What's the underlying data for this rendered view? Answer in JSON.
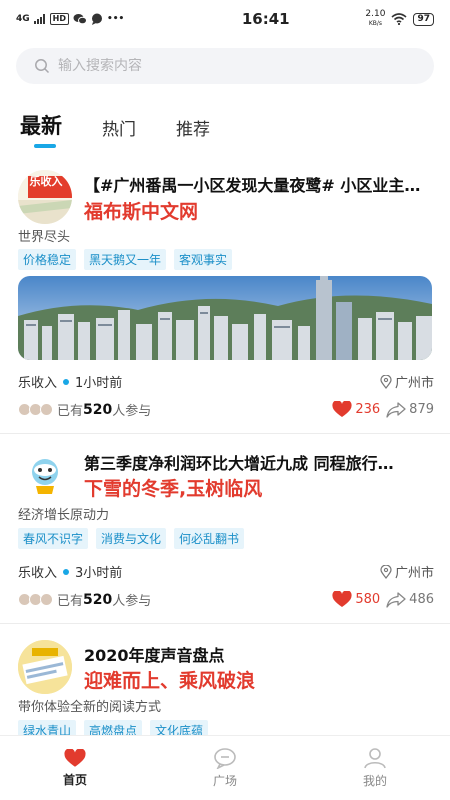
{
  "status_bar": {
    "signal_label": "4G",
    "hd_label": "HD",
    "more": "•••",
    "time": "16:41",
    "speed_value": "2.10",
    "speed_unit": "KB/s",
    "battery": "97"
  },
  "search": {
    "placeholder": "输入搜索内容"
  },
  "tabs": [
    {
      "label": "最新",
      "active": true
    },
    {
      "label": "热门",
      "active": false
    },
    {
      "label": "推荐",
      "active": false
    }
  ],
  "posts": [
    {
      "avatar_text": "乐收入",
      "title": "【#广州番禺一小区发现大量夜鹭# 小区业主称…",
      "subtitle": "福布斯中文网",
      "desc": "世界尽头",
      "tags": [
        "价格稳定",
        "黑天鹅又一年",
        "客观事实"
      ],
      "author": "乐收入",
      "time": "1小时前",
      "location": "广州市",
      "participants_prefix": "已有",
      "participants_count": "520",
      "participants_suffix": "人参与",
      "likes": "236",
      "shares": "879"
    },
    {
      "title": "第三季度净利润环比大增近九成 同程旅行…",
      "subtitle": "下雪的冬季,玉树临风",
      "desc": "经济增长原动力",
      "tags": [
        "春风不识字",
        "消费与文化",
        "何必乱翻书"
      ],
      "author": "乐收入",
      "time": "3小时前",
      "location": "广州市",
      "participants_prefix": "已有",
      "participants_count": "520",
      "participants_suffix": "人参与",
      "likes": "580",
      "shares": "486"
    },
    {
      "title": "2020年度声音盘点",
      "subtitle": "迎难而上、乘风破浪",
      "desc": "带你体验全新的阅读方式",
      "tags": [
        "绿水青山",
        "高燃盘点",
        "文化底蕴"
      ]
    }
  ],
  "bottom_nav": [
    {
      "label": "首页",
      "icon": "heart-icon",
      "active": true
    },
    {
      "label": "广场",
      "icon": "chat-bubble-icon",
      "active": false
    },
    {
      "label": "我的",
      "icon": "user-icon",
      "active": false
    }
  ],
  "colors": {
    "accent": "#19a7e6",
    "like_red": "#e23b2e",
    "tag_bg": "#e6f4fb"
  }
}
